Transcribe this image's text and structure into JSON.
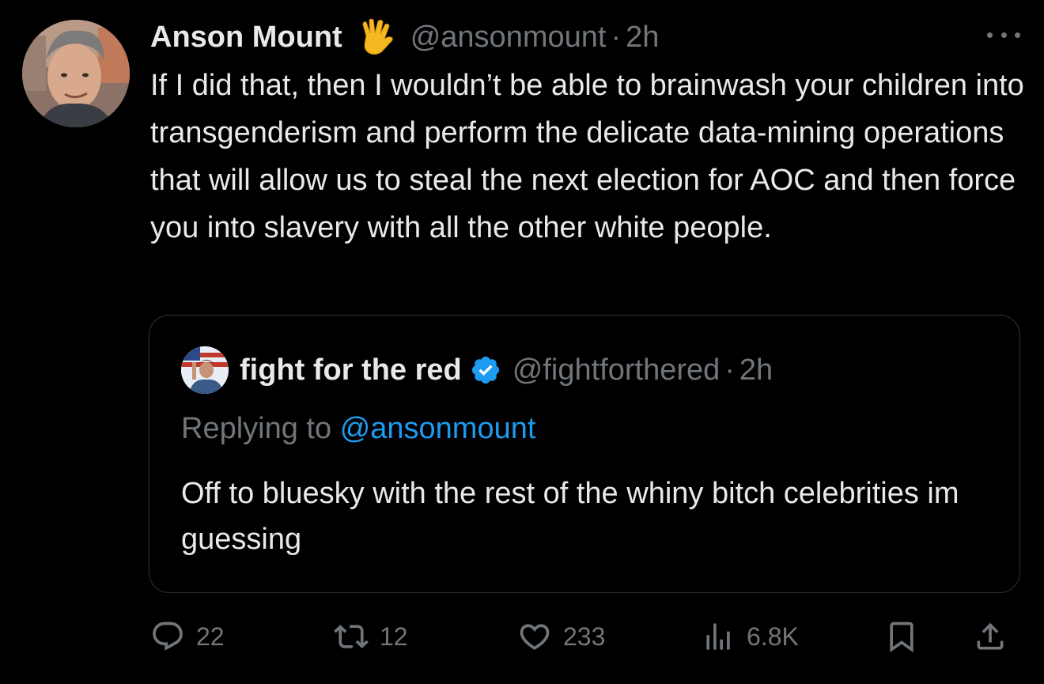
{
  "tweet": {
    "display_name": "Anson Mount",
    "handle": "@ansonmount",
    "separator": "·",
    "time": "2h",
    "text": "If I did that, then I wouldn’t be able to brainwash your children into transgenderism and perform the delicate data-mining operations that will allow us to steal the next election for AOC and then force you into slavery with all the other white people.",
    "name_emoji_icon": "vulcan-salute-icon"
  },
  "quote": {
    "display_name": "fight for the red",
    "handle": "@fightforthered",
    "separator": "·",
    "time": "2h",
    "verified": true,
    "replying_prefix": "Replying to",
    "replying_to": "@ansonmount",
    "text": "Off to bluesky with the rest of the whiny bitch celebrities im guessing"
  },
  "actions": {
    "replies": "22",
    "reposts": "12",
    "likes": "233",
    "views": "6.8K"
  },
  "colors": {
    "background": "#000000",
    "text": "#e7e9ea",
    "secondary": "#71767b",
    "accent": "#1d9bf0",
    "border": "#2f3336"
  }
}
